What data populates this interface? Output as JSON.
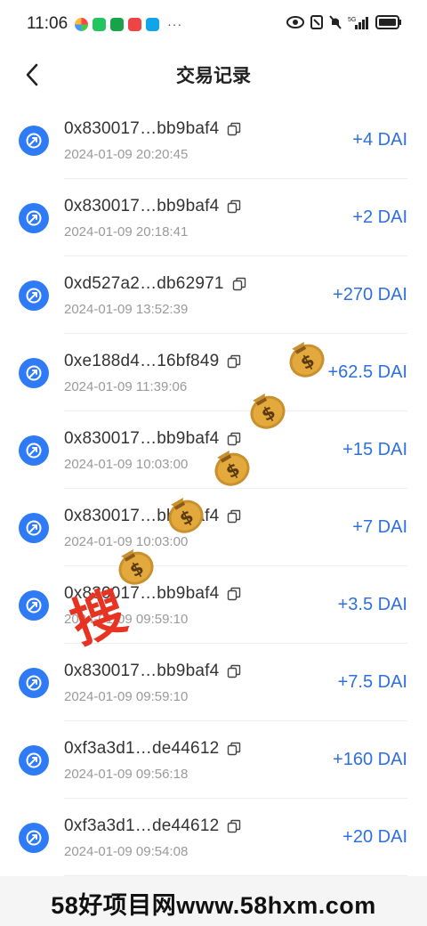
{
  "status_bar": {
    "time": "11:06",
    "dots": "···",
    "network": "5G"
  },
  "header": {
    "title": "交易记录"
  },
  "transactions": [
    {
      "address": "0x830017…bb9baf4",
      "time": "2024-01-09 20:20:45",
      "amount": "+4 DAI"
    },
    {
      "address": "0x830017…bb9baf4",
      "time": "2024-01-09 20:18:41",
      "amount": "+2 DAI"
    },
    {
      "address": "0xd527a2…db62971",
      "time": "2024-01-09 13:52:39",
      "amount": "+270 DAI"
    },
    {
      "address": "0xe188d4…16bf849",
      "time": "2024-01-09 11:39:06",
      "amount": "+62.5 DAI"
    },
    {
      "address": "0x830017…bb9baf4",
      "time": "2024-01-09 10:03:00",
      "amount": "+15 DAI"
    },
    {
      "address": "0x830017…bb9baf4",
      "time": "2024-01-09 10:03:00",
      "amount": "+7 DAI"
    },
    {
      "address": "0x830017…bb9baf4",
      "time": "2024-01-09 09:59:10",
      "amount": "+3.5 DAI"
    },
    {
      "address": "0x830017…bb9baf4",
      "time": "2024-01-09 09:59:10",
      "amount": "+7.5 DAI"
    },
    {
      "address": "0xf3a3d1…de44612",
      "time": "2024-01-09 09:56:18",
      "amount": "+160 DAI"
    },
    {
      "address": "0xf3a3d1…de44612",
      "time": "2024-01-09 09:54:08",
      "amount": "+20 DAI"
    }
  ],
  "watermark": "58好项目网www.58hxm.com",
  "stamp_text": "搜",
  "colors": {
    "accent": "#2f7bf5",
    "amount": "#2f6fdf"
  }
}
